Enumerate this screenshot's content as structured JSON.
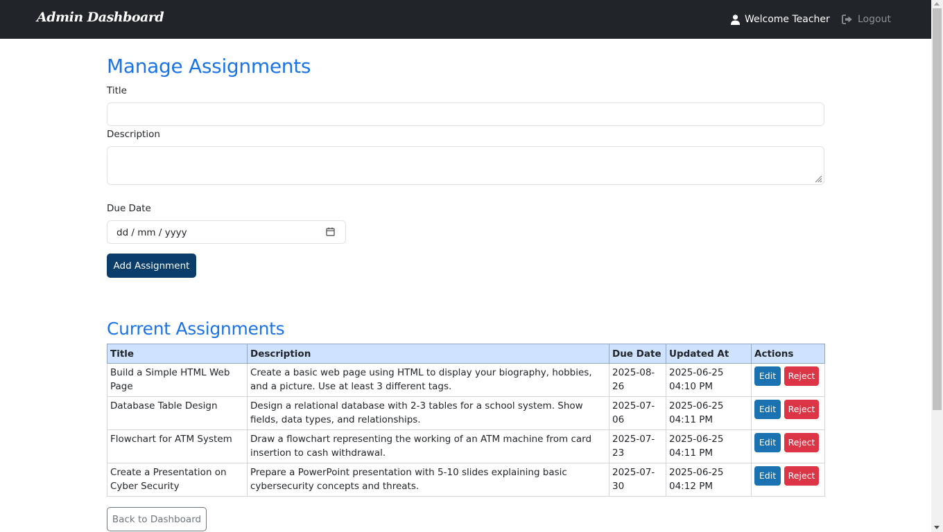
{
  "navbar": {
    "brand": "Admin Dashboard",
    "user_label": "Welcome Teacher",
    "user_icon": "user-icon",
    "logout_label": "Logout",
    "logout_icon": "sign-out-icon",
    "background": "#212529"
  },
  "form": {
    "heading": "Manage Assignments",
    "title_label": "Title",
    "title_value": "",
    "description_label": "Description",
    "description_value": "",
    "due_date_label": "Due Date",
    "due_date_placeholder": "dd / mm / yyyy",
    "calendar_icon": "calendar-icon",
    "submit_label": "Add Assignment",
    "submit_color": "#0b3d6b"
  },
  "assignments": {
    "heading": "Current Assignments",
    "columns": [
      "Title",
      "Description",
      "Due Date",
      "Updated At",
      "Actions"
    ],
    "header_color": "#cfe2ff",
    "edit_label": "Edit",
    "reject_label": "Reject",
    "rows": [
      {
        "title": "Build a Simple HTML Web Page",
        "description": "Create a basic web page using HTML to display your biography, hobbies, and a picture. Use at least 3 different tags.",
        "due_date": "2025-08-26",
        "updated_at": "2025-06-25 04:10 PM"
      },
      {
        "title": "Database Table Design",
        "description": "Design a relational database with 2-3 tables for a school system. Show fields, data types, and relationships.",
        "due_date": "2025-07-06",
        "updated_at": "2025-06-25 04:11 PM"
      },
      {
        "title": "Flowchart for ATM System",
        "description": "Draw a flowchart representing the working of an ATM machine from card insertion to cash withdrawal.",
        "due_date": "2025-07-23",
        "updated_at": "2025-06-25 04:11 PM"
      },
      {
        "title": "Create a Presentation on Cyber Security",
        "description": "Prepare a PowerPoint presentation with 5-10 slides explaining basic cybersecurity concepts and threats.",
        "due_date": "2025-07-30",
        "updated_at": "2025-06-25 04:12 PM"
      }
    ]
  },
  "footer": {
    "back_label": "Back to Dashboard"
  }
}
